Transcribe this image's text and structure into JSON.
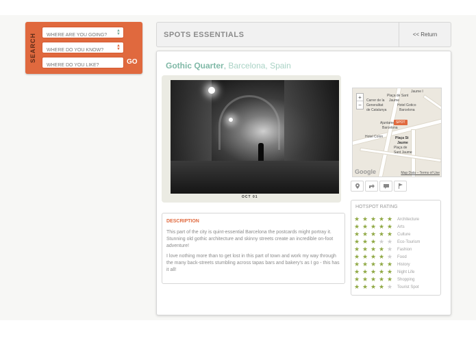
{
  "search": {
    "label": "SEARCH",
    "field1_placeholder": "WHERE ARE YOU GOING?",
    "field2_placeholder": "WHERE DO YOU KNOW?",
    "field3_placeholder": "WHERE DO YOU LIKE?",
    "go_label": "GO"
  },
  "header": {
    "title": "SPOTS ESSENTIALS",
    "return_label": "<< Return"
  },
  "spot": {
    "name": "Gothic Quarter",
    "separator": ",",
    "location": "Barcelona, Spain",
    "photo_caption": "OCT  01"
  },
  "map": {
    "zoom_in": "+",
    "zoom_out": "−",
    "labels": {
      "jaume": "Jaume I",
      "placa_sant": "Plaça de Sant",
      "jaume_st": "Jaume",
      "carrer": "Carrer de la",
      "generalitat": "Generalitat",
      "catalunya": "de Catalunya",
      "hotel_gotico": "Hotel Gotico",
      "barcelona1": "Barcelona",
      "ajuntament": "Ajuntament de",
      "barcelona2": "Barcelona",
      "hotel_colon": "Hotel Colon",
      "placa_st": "Plaça St",
      "jaume2": "Jaume",
      "placa_de": "Plaça de",
      "sant_jaume": "Sant Jaume"
    },
    "marker": "SPOT",
    "logo": "Google",
    "links": "Map Data – Terms of Use"
  },
  "icons": [
    "location-pin-icon",
    "share-icon",
    "comment-icon",
    "flag-icon"
  ],
  "rating": {
    "title": "HOTSPOT RATING",
    "items": [
      {
        "label": "Architecture",
        "stars": 5
      },
      {
        "label": "Arts",
        "stars": 5
      },
      {
        "label": "Culture",
        "stars": 5
      },
      {
        "label": "Eco-Tourism",
        "stars": 3
      },
      {
        "label": "Fashion",
        "stars": 4
      },
      {
        "label": "Food",
        "stars": 4
      },
      {
        "label": "History",
        "stars": 5
      },
      {
        "label": "Night Life",
        "stars": 5
      },
      {
        "label": "Shopping",
        "stars": 5
      },
      {
        "label": "Tourist Spot",
        "stars": 4
      }
    ]
  },
  "description": {
    "title": "DESCRIPTION",
    "p1": "This part of the city is quint-essential Barcelona the postcards might portray it. Stunning old gothic architecture and skinny streets create an incredible on-foot adventure!",
    "p2": "I love nothing more than to get lost in this part of town and work my way through the many back-streets stumbling across tapas bars and bakery's as I go - this has it all!"
  },
  "colors": {
    "accent": "#e0693e",
    "teal": "#7fb8a6",
    "star_on": "#8fa843",
    "star_off": "#cfcfcf"
  }
}
